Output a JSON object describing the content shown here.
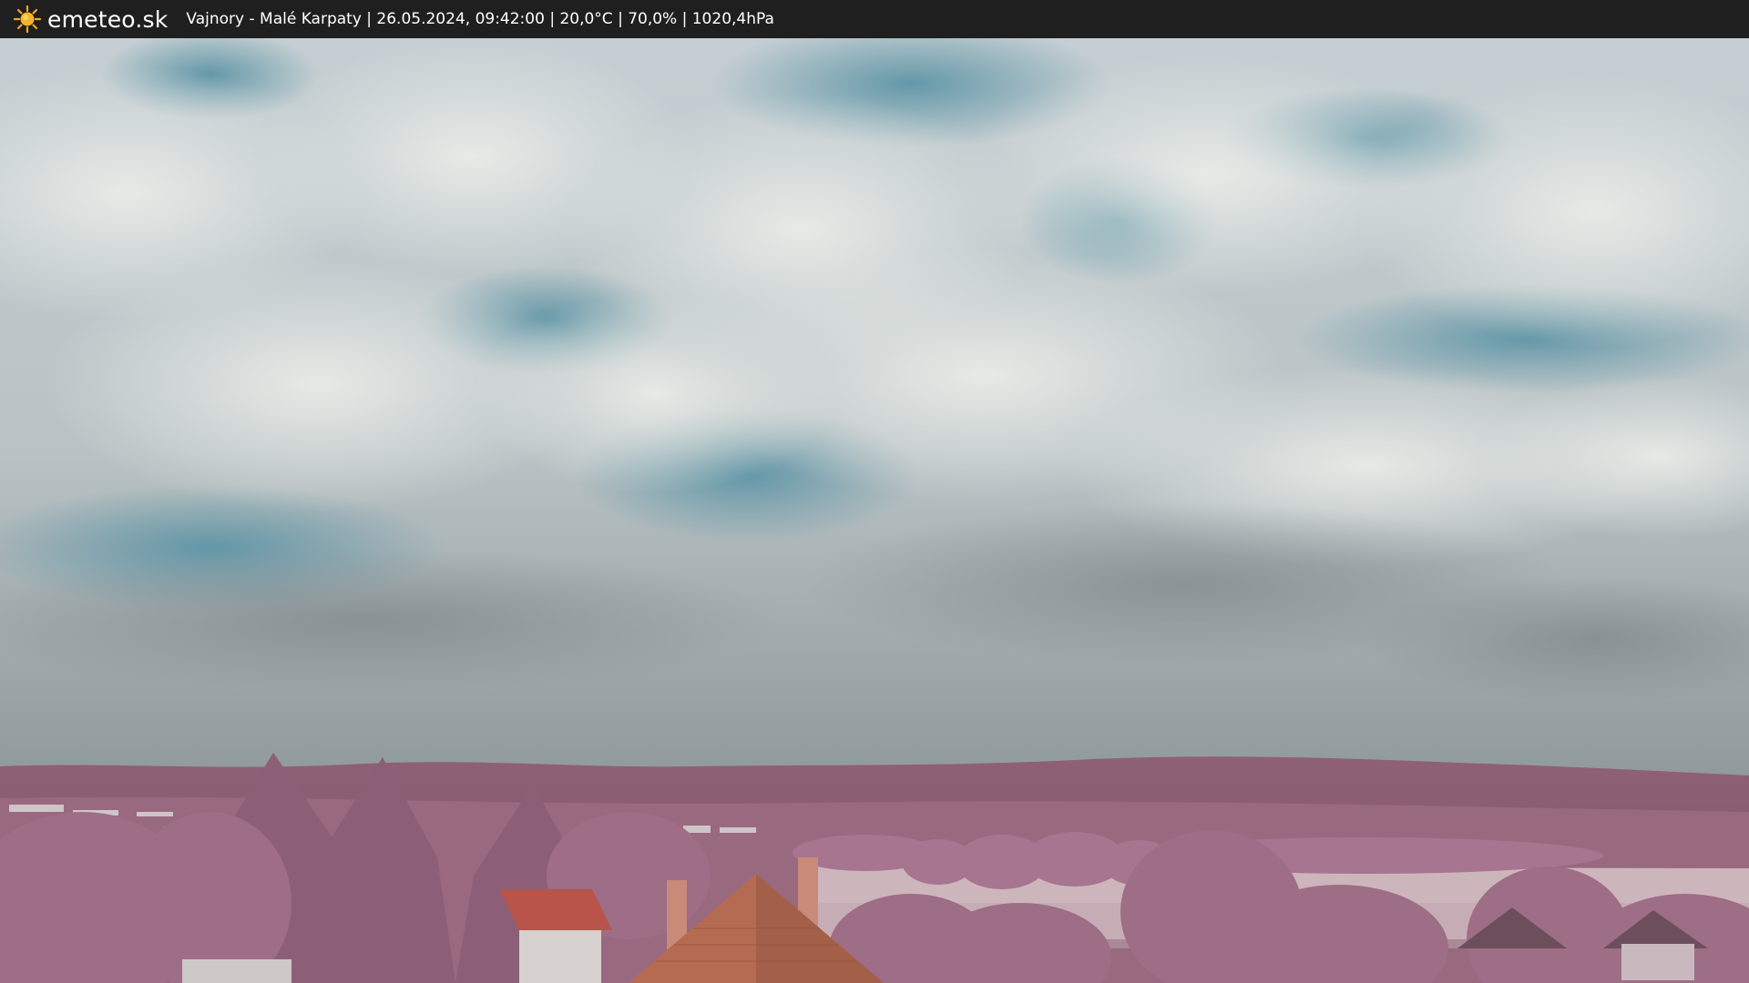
{
  "header": {
    "brand": "emeteo.sk",
    "brand_icon": "sun-icon",
    "status_line": "Vajnory - Malé Karpaty | 26.05.2024, 09:42:00 | 20,0°C | 70,0% | 1020,4hPa"
  },
  "colors": {
    "bar_background": "#1f1f1f",
    "sun": "#f5a623",
    "sky_blue": "#6f9cab",
    "clouds": "#d9dbd8",
    "foliage": "#a7758f",
    "roof": "#b8644a"
  }
}
